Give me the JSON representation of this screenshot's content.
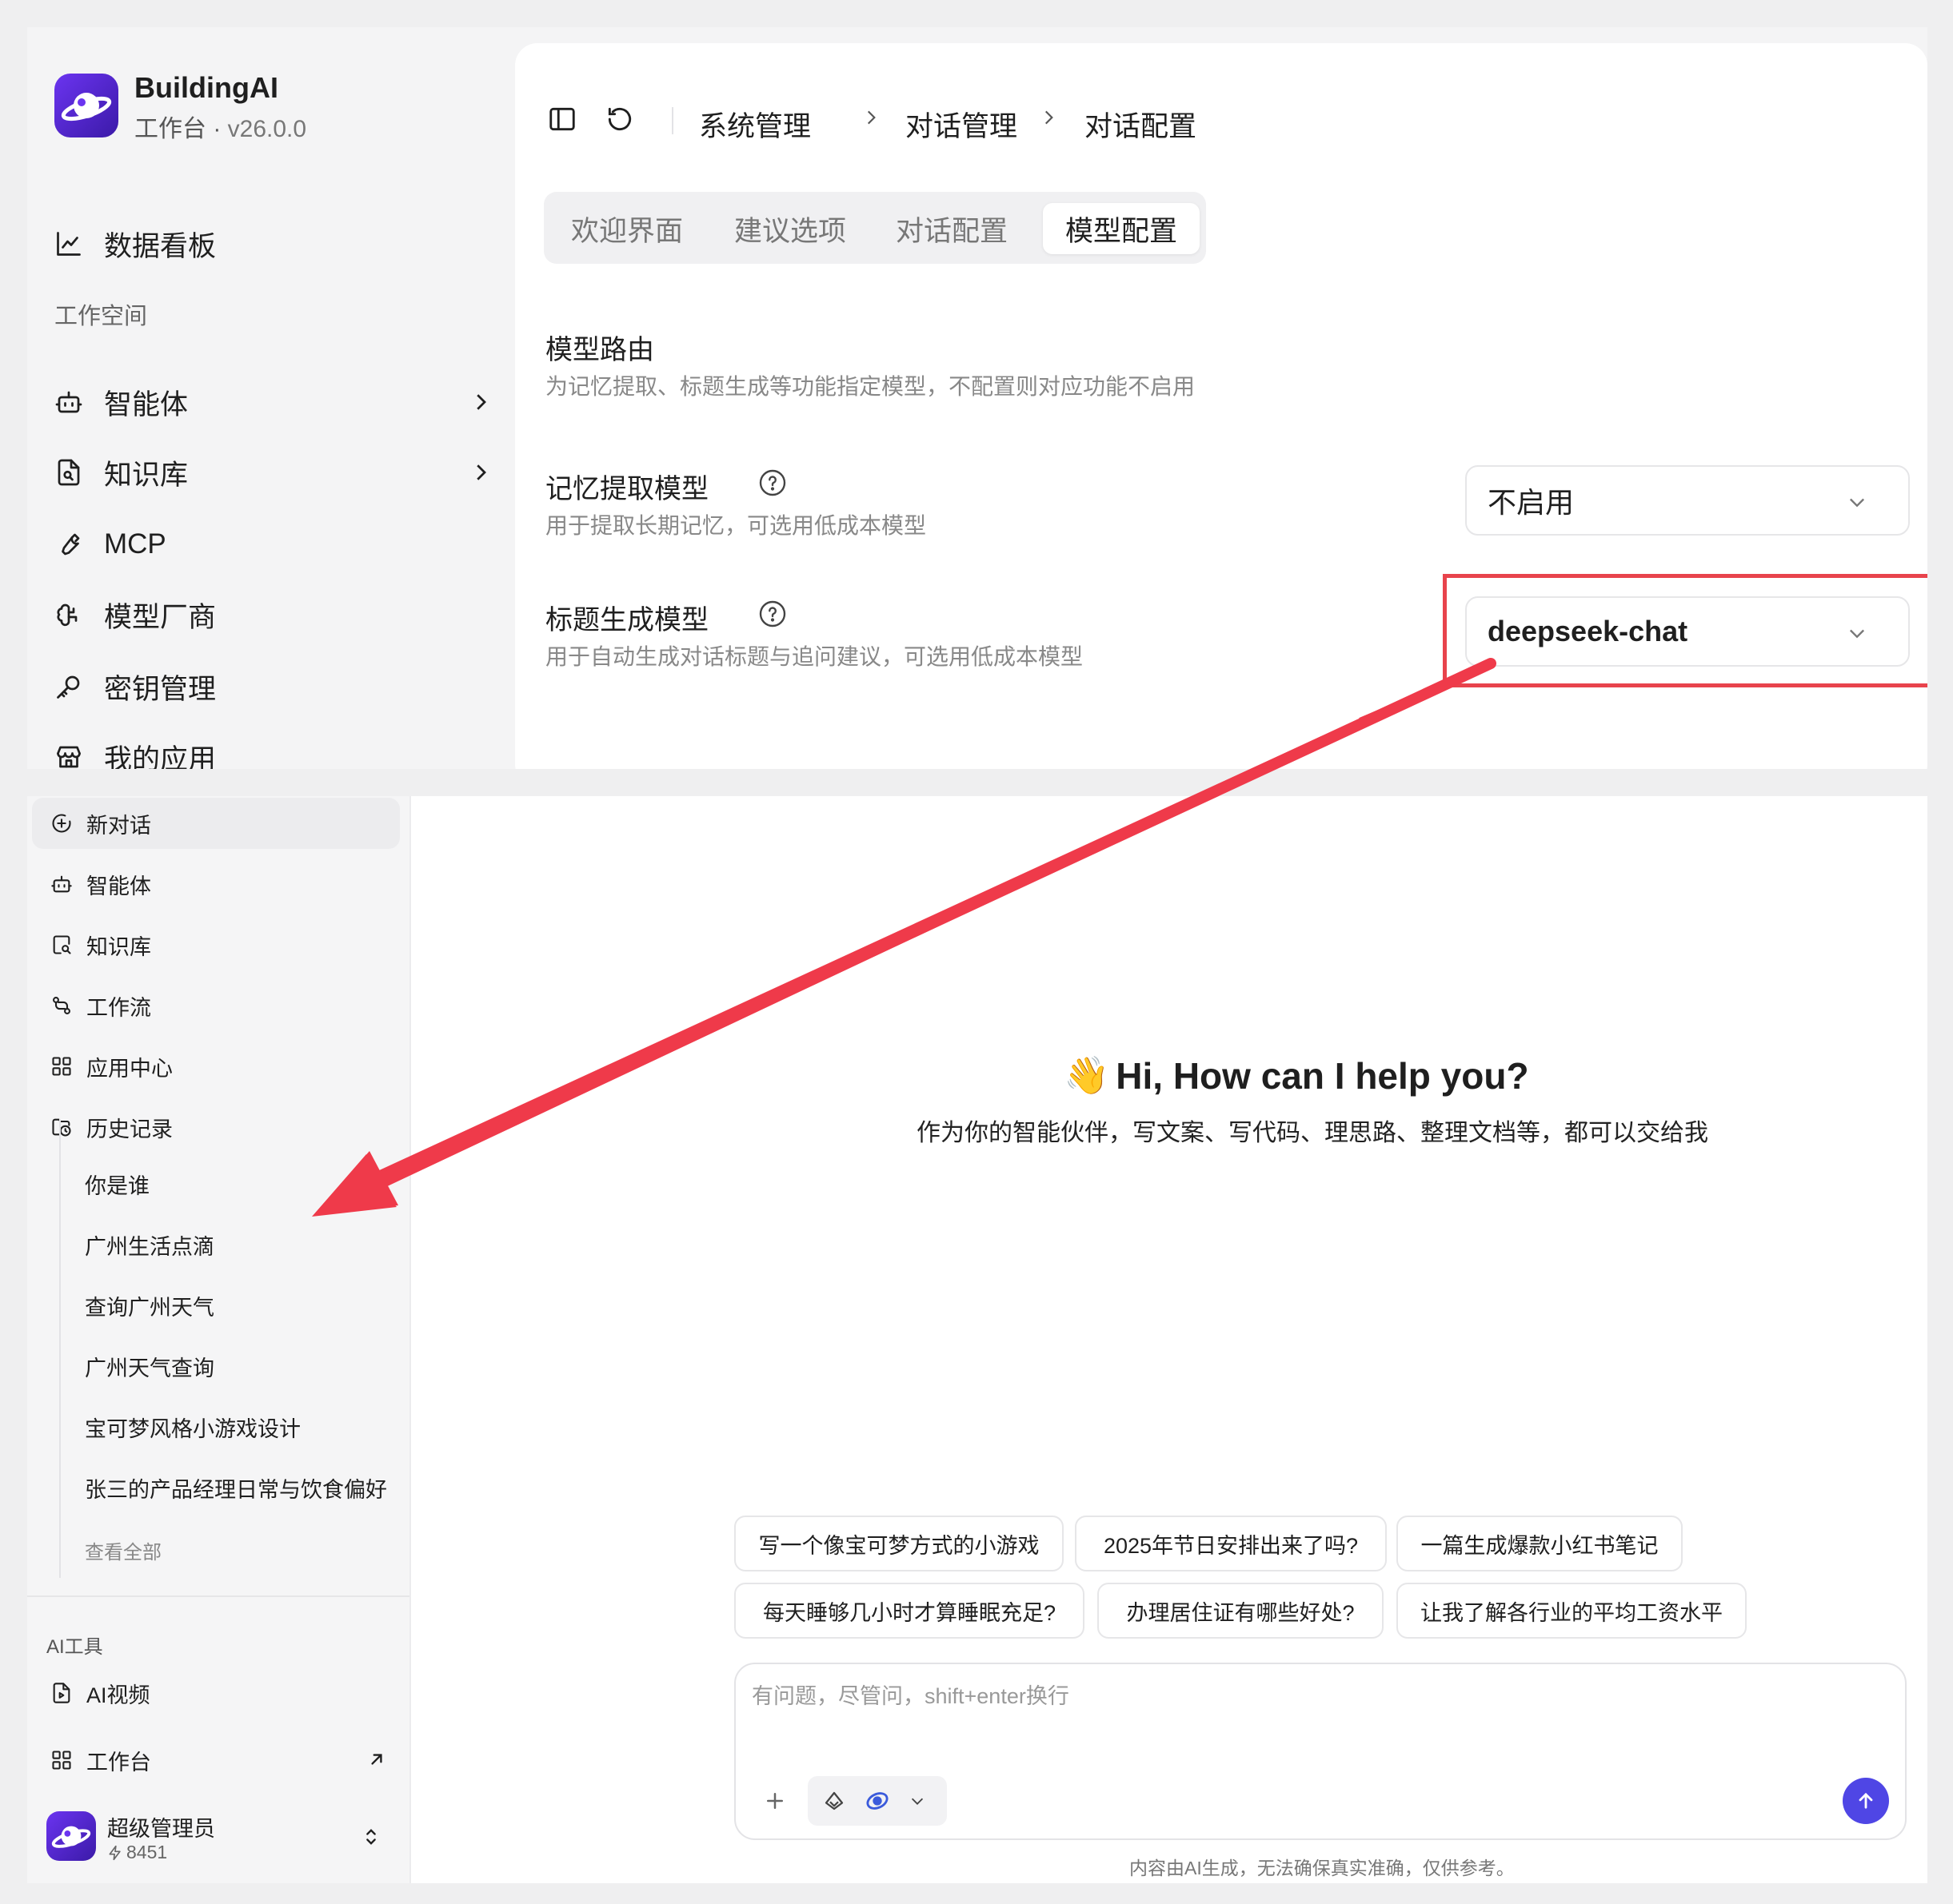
{
  "top": {
    "brand": {
      "name": "BuildingAI",
      "sub": "工作台 · ",
      "version": "v26.0.0"
    },
    "nav": {
      "dashboard": "数据看板",
      "section": "工作空间",
      "agents": "智能体",
      "knowledge": "知识库",
      "mcp": "MCP",
      "providers": "模型厂商",
      "keys": "密钥管理",
      "apps": "我的应用"
    },
    "breadcrumb": [
      "系统管理",
      "对话管理",
      "对话配置"
    ],
    "tabs": [
      "欢迎界面",
      "建议选项",
      "对话配置",
      "模型配置"
    ],
    "active_tab": "模型配置",
    "routing": {
      "title": "模型路由",
      "desc": "为记忆提取、标题生成等功能指定模型，不配置则对应功能不启用"
    },
    "memory": {
      "title": "记忆提取模型",
      "desc": "用于提取长期记忆，可选用低成本模型",
      "value": "不启用"
    },
    "title_model": {
      "title": "标题生成模型",
      "desc": "用于自动生成对话标题与追问建议，可选用低成本模型",
      "value": "deepseek-chat"
    }
  },
  "bottom": {
    "nav": {
      "new_chat": "新对话",
      "agents": "智能体",
      "knowledge": "知识库",
      "workflow": "工作流",
      "app_center": "应用中心",
      "history": "历史记录"
    },
    "history": [
      "你是谁",
      "广州生活点滴",
      "查询广州天气",
      "广州天气查询",
      "宝可梦风格小游戏设计",
      "张三的产品经理日常与饮食偏好"
    ],
    "see_all": "查看全部",
    "ai_tools_label": "AI工具",
    "ai_video": "AI视频",
    "workbench": "工作台",
    "user": {
      "name": "超级管理员",
      "points": "8451"
    },
    "greeting": {
      "emoji": "👋",
      "title": "Hi, How can I help you?",
      "subtitle": "作为你的智能伙伴，写文案、写代码、理思路、整理文档等，都可以交给我"
    },
    "suggestions_row1": [
      "写一个像宝可梦方式的小游戏",
      "2025年节日安排出来了吗?",
      "一篇生成爆款小红书笔记"
    ],
    "suggestions_row2": [
      "每天睡够几小时才算睡眠充足?",
      "办理居住证有哪些好处?",
      "让我了解各行业的平均工资水平"
    ],
    "input_placeholder": "有问题，尽管问，shift+enter换行",
    "disclaimer": "内容由AI生成，无法确保真实准确，仅供参考。"
  },
  "colors": {
    "accent": "#4f46e5",
    "highlight": "#e8434c",
    "arrow": "#ef3a4a",
    "logo": "#6b34f0"
  }
}
